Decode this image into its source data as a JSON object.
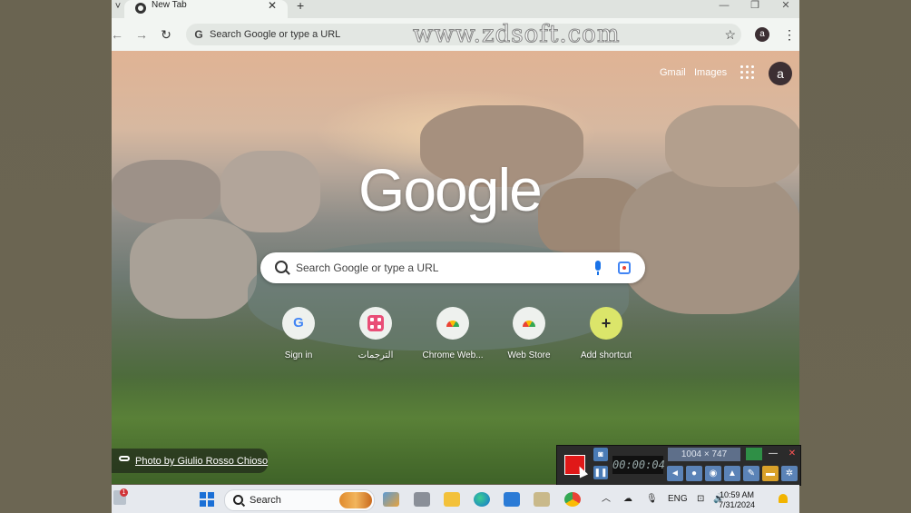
{
  "tabstrip": {
    "tab_search_glyph": "˅",
    "tab": {
      "title": "New Tab",
      "close_glyph": "✕"
    },
    "new_tab_glyph": "+",
    "window_controls": {
      "minimize": "—",
      "restore": "❐",
      "close": "✕"
    }
  },
  "toolbar": {
    "back_glyph": "←",
    "forward_glyph": "→",
    "reload_glyph": "↻",
    "omnibox_g": "G",
    "omnibox_placeholder": "Search Google or type a URL",
    "bookmark_glyph": "☆",
    "profile_initial": "a",
    "menu_glyph": "⋮"
  },
  "watermark": "www.zdsoft.com",
  "ntp": {
    "top_links": {
      "gmail": "Gmail",
      "images": "Images"
    },
    "avatar_initial": "a",
    "logo": "Google",
    "search_placeholder": "Search Google or type a URL",
    "shortcuts": [
      {
        "label": "Sign in",
        "glyph": "G"
      },
      {
        "label": "الترجمات",
        "glyph": ""
      },
      {
        "label": "Chrome Web...",
        "glyph": ""
      },
      {
        "label": "Web Store",
        "glyph": ""
      },
      {
        "label": "Add shortcut",
        "glyph": "+"
      }
    ],
    "photo_credit": "Photo by Giulio Rosso Chioso"
  },
  "recorder": {
    "timer": "00:00:04",
    "dimensions": "1004 × 747",
    "minimize_glyph": "—",
    "close_glyph": "✕",
    "pause_glyph": "❚❚",
    "camera_glyph": "◙"
  },
  "taskbar": {
    "notification_count": "1",
    "search_label": "Search",
    "language": "ENG",
    "time": "10:59 AM",
    "date": "7/31/2024",
    "tray_chevron": "︿"
  }
}
